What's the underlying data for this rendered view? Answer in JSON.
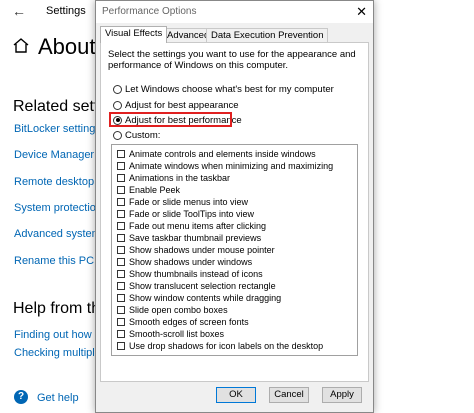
{
  "background": {
    "window_title": "Settings",
    "page_title": "About",
    "related_heading": "Related settin",
    "related_links": [
      "BitLocker settings",
      "Device Manager",
      "Remote desktop",
      "System protection",
      "Advanced system s",
      "Rename this PC (ac"
    ],
    "help_heading": "Help from the",
    "help_links": [
      "Finding out how m",
      "Checking multiple"
    ],
    "get_help": "Get help"
  },
  "dialog": {
    "title": "Performance Options",
    "close_glyph": "✕",
    "tabs": [
      "Visual Effects",
      "Advanced",
      "Data Execution Prevention"
    ],
    "description": "Select the settings you want to use for the appearance and performance of Windows on this computer.",
    "radios": [
      "Let Windows choose what's best for my computer",
      "Adjust for best appearance",
      "Adjust for best performance",
      "Custom:"
    ],
    "selected_radio": "Adjust for best performance",
    "effects": [
      "Animate controls and elements inside windows",
      "Animate windows when minimizing and maximizing",
      "Animations in the taskbar",
      "Enable Peek",
      "Fade or slide menus into view",
      "Fade or slide ToolTips into view",
      "Fade out menu items after clicking",
      "Save taskbar thumbnail previews",
      "Show shadows under mouse pointer",
      "Show shadows under windows",
      "Show thumbnails instead of icons",
      "Show translucent selection rectangle",
      "Show window contents while dragging",
      "Slide open combo boxes",
      "Smooth edges of screen fonts",
      "Smooth-scroll list boxes",
      "Use drop shadows for icon labels on the desktop"
    ],
    "buttons": {
      "ok": "OK",
      "cancel": "Cancel",
      "apply": "Apply"
    },
    "highlight_color": "#e02020"
  }
}
